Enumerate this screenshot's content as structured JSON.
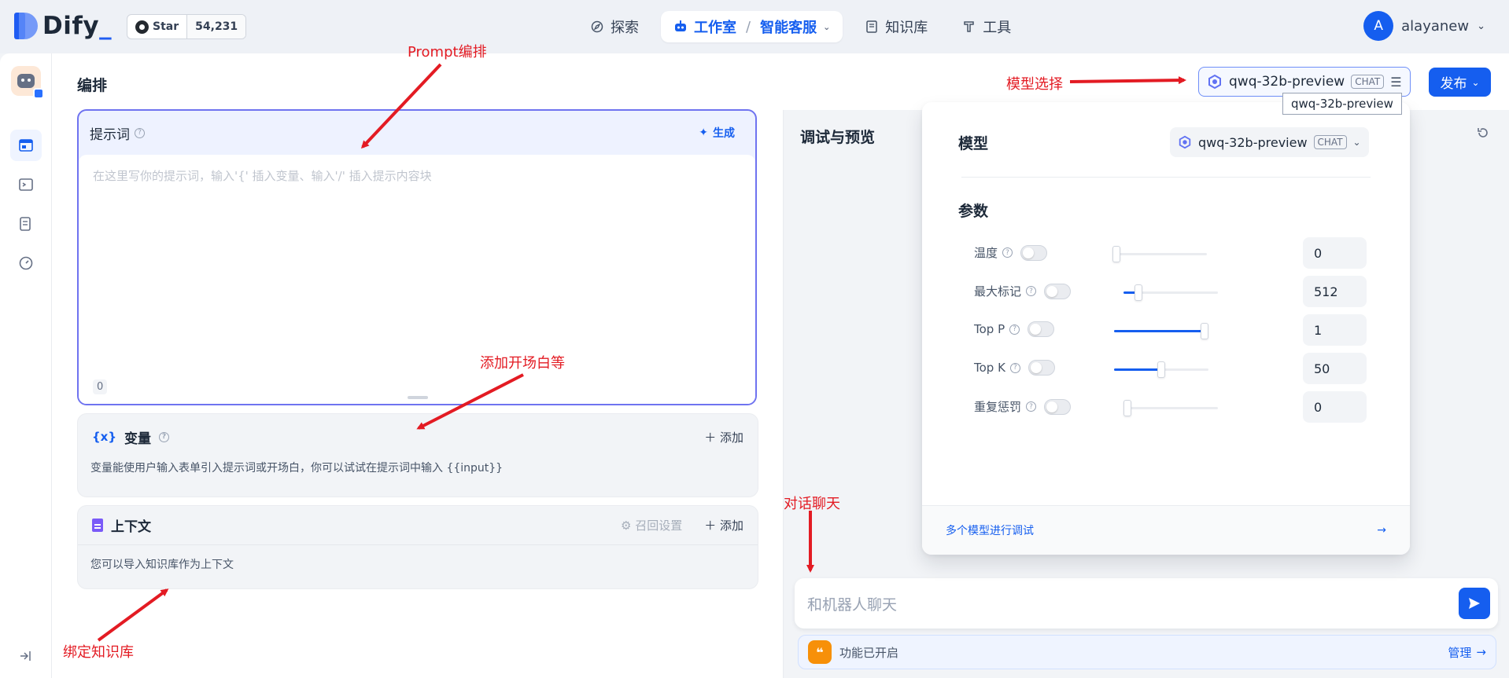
{
  "header": {
    "logo_text": "Dify",
    "logo_suffix": "_",
    "github_star_label": "Star",
    "github_star_count": "54,231",
    "nav": [
      {
        "label": "探索"
      },
      {
        "label": "工作室",
        "sub": "智能客服"
      },
      {
        "label": "知识库"
      },
      {
        "label": "工具"
      }
    ],
    "user": {
      "initial": "A",
      "name": "alayanew"
    }
  },
  "editor": {
    "title": "编排",
    "prompt": {
      "title": "提示词",
      "generate_label": "生成",
      "placeholder": "在这里写你的提示词，输入'{' 插入变量、输入'/' 插入提示内容块",
      "char_count": "0"
    },
    "variables": {
      "icon": "{x}",
      "title": "变量",
      "add_label": "添加",
      "description": "变量能使用户输入表单引入提示词或开场白，你可以试试在提示词中输入 {{input}}"
    },
    "context": {
      "title": "上下文",
      "recall_label": "召回设置",
      "add_label": "添加",
      "description": "您可以导入知识库作为上下文"
    }
  },
  "model_selector": {
    "model_name": "qwq-32b-preview",
    "tag": "CHAT",
    "tooltip": "qwq-32b-preview"
  },
  "publish_label": "发布",
  "debug": {
    "title": "调试与预览",
    "chat_placeholder": "和机器人聊天",
    "feature_status": "功能已开启",
    "manage_label": "管理"
  },
  "param_panel": {
    "model_label": "模型",
    "model_name": "qwq-32b-preview",
    "model_tag": "CHAT",
    "params_label": "参数",
    "params": [
      {
        "label": "温度",
        "value": "0",
        "fraction": 0.0
      },
      {
        "label": "最大标记",
        "value": "512",
        "fraction": 0.13
      },
      {
        "label": "Top P",
        "value": "1",
        "fraction": 1.0
      },
      {
        "label": "Top K",
        "value": "50",
        "fraction": 0.5
      },
      {
        "label": "重复惩罚",
        "value": "0",
        "fraction": 0.0
      }
    ],
    "multi_model_label": "多个模型进行调试"
  },
  "annotations": {
    "prompt": "Prompt编排",
    "model": "模型选择",
    "opening": "添加开场白等",
    "chat": "对话聊天",
    "knowledge": "绑定知识库"
  },
  "colors": {
    "accent": "#155eef",
    "annotation": "#e31b23",
    "prompt_border": "#6f73f0"
  }
}
